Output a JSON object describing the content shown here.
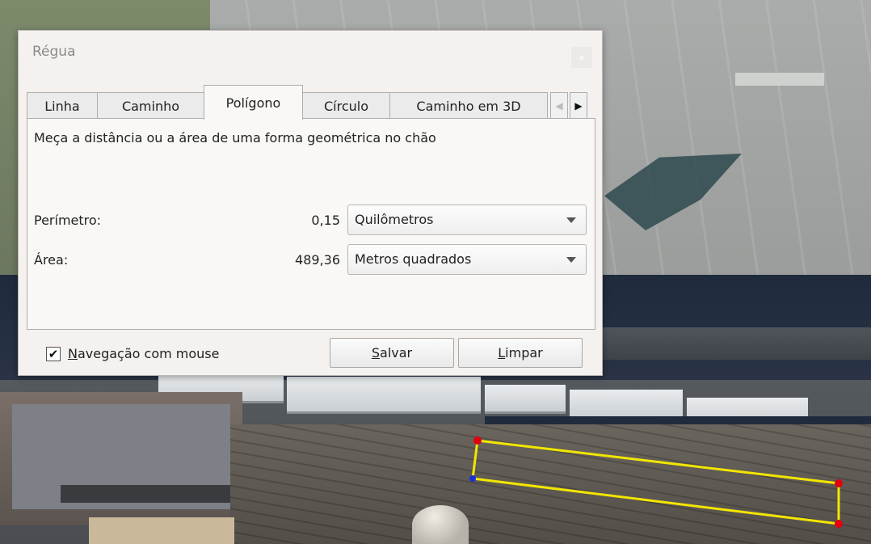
{
  "dialog": {
    "title": "Régua",
    "close_glyph": "×",
    "tabs": [
      {
        "label": "Linha",
        "active": false
      },
      {
        "label": "Caminho",
        "active": false
      },
      {
        "label": "Polígono",
        "active": true
      },
      {
        "label": "Círculo",
        "active": false
      },
      {
        "label": "Caminho em 3D",
        "active": false
      }
    ],
    "scroll_left_glyph": "◀",
    "scroll_right_glyph": "▶",
    "description": "Meça a distância ou a área de uma forma geométrica no chão",
    "perimeter": {
      "label": "Perímetro:",
      "value": "0,15",
      "unit": "Quilômetros"
    },
    "area": {
      "label": "Área:",
      "value": "489,36",
      "unit": "Metros quadrados"
    },
    "mouse_nav": {
      "checked": true,
      "check_glyph": "✔",
      "label_first": "N",
      "label_rest": "avegação com mouse"
    },
    "save_button": {
      "first": "S",
      "rest": "alvar"
    },
    "clear_button": {
      "first": "L",
      "rest": "impar"
    }
  },
  "colors": {
    "polygon_line": "#f2e600",
    "vertex": "#e3000f",
    "vertex_active": "#1a2fd6"
  }
}
